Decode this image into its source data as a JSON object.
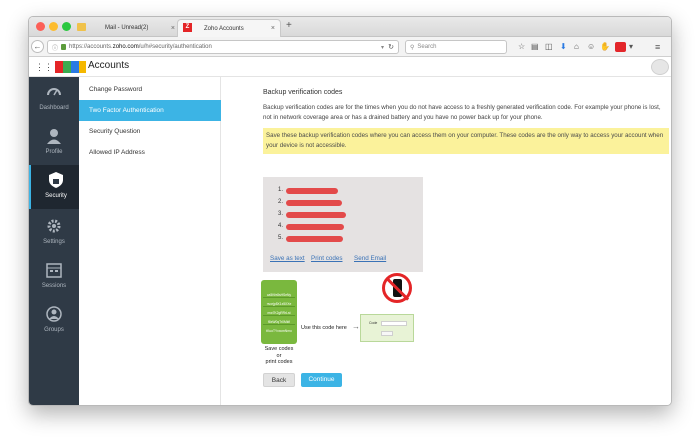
{
  "browser": {
    "tabs": [
      {
        "label": "Mail - Unread(2)"
      },
      {
        "label": "Zoho Accounts"
      }
    ],
    "url_prefix": "https://accounts.",
    "url_domain": "zoho.com",
    "url_path": "/u/h#security/authentication",
    "search_placeholder": "Search"
  },
  "app": {
    "logo_text": "ZOHO",
    "title": "Accounts"
  },
  "leftnav": {
    "items": [
      {
        "label": "Dashboard",
        "icon": "dashboard-icon"
      },
      {
        "label": "Profile",
        "icon": "user-icon"
      },
      {
        "label": "Security",
        "icon": "shield-icon"
      },
      {
        "label": "Settings",
        "icon": "gear-icon"
      },
      {
        "label": "Sessions",
        "icon": "calendar-icon"
      },
      {
        "label": "Groups",
        "icon": "groups-icon"
      }
    ]
  },
  "subnav": {
    "items": [
      {
        "label": "Change Password"
      },
      {
        "label": "Two Factor Authentication"
      },
      {
        "label": "Security Question"
      },
      {
        "label": "Allowed IP Address"
      }
    ]
  },
  "main": {
    "heading": "Backup verification codes",
    "description": "Backup verification codes are for the times when you do not have access to a freshly generated verification code. For example your phone is lost, not in network coverage area or has a drained battery and you have no power back up for your phone.",
    "note": "Save these backup verification codes where you can access them on your computer. These codes are the only way to access your account when your device is not accessible.",
    "code_numbers": [
      "1.",
      "2.",
      "3.",
      "4.",
      "5."
    ],
    "links": {
      "save_text": "Save as text",
      "print_codes": "Print codes",
      "send_email": "Send Email"
    },
    "illustration": {
      "ticket_lines": [
        "ca5Kfe8sHSeNy",
        "nvorjp8X1x5XXe",
        "mw7K2gRRrLst",
        "f8xW0qTr0Mkfi",
        "tKuoTYxxcmNmo"
      ],
      "save_caption": "Save codes\nor\nprint codes",
      "use_caption": "Use this code here",
      "code_label": "Code"
    },
    "buttons": {
      "back": "Back",
      "continue": "Continue"
    }
  },
  "colors": {
    "accent": "#3cb4e5",
    "nav_bg": "#2f3a46",
    "note_bg": "#fbf29b",
    "link": "#3a72b6"
  }
}
